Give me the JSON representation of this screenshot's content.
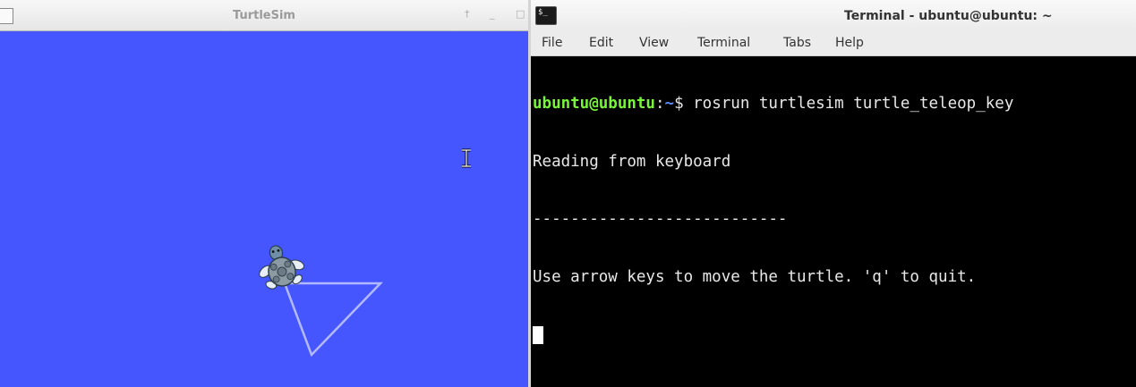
{
  "turtlesim": {
    "title": "TurtleSim",
    "controls": {
      "pin": "†",
      "minimize": "_",
      "maximize": "□"
    },
    "background_color": "#4556ff",
    "path_color": "#b3b9ff",
    "icons": {
      "app": "window-icon",
      "turtle": "turtle-icon"
    }
  },
  "terminal": {
    "title": "Terminal - ubuntu@ubuntu: ~",
    "menu": [
      "File",
      "Edit",
      "View",
      "Terminal",
      "Tabs",
      "Help"
    ],
    "prompt_user": "ubuntu@ubuntu",
    "prompt_sep": ":",
    "prompt_path": "~",
    "prompt_symbol": "$ ",
    "command": "rosrun turtlesim turtle_teleop_key",
    "output_lines": [
      "Reading from keyboard",
      "---------------------------",
      "Use arrow keys to move the turtle. 'q' to quit."
    ],
    "colors": {
      "user": "#79f43a",
      "path": "#5a8cff",
      "text": "#e8e8e8",
      "background": "#000000"
    }
  }
}
